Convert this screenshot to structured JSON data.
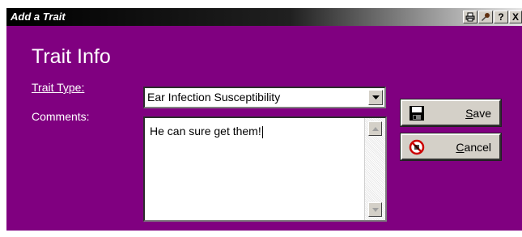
{
  "window": {
    "title": "Add a Trait",
    "colors": {
      "background": "#800080",
      "titlebar": "#000000"
    },
    "controls": {
      "help": "?",
      "close": "X"
    }
  },
  "form": {
    "heading": "Trait Info",
    "trait_type_label": "Trait Type:",
    "trait_type_value": "Ear Infection Susceptibility",
    "comments_label": "Comments:",
    "comments_value": "He can sure get them!"
  },
  "buttons": {
    "save": {
      "mnemonic": "S",
      "rest": "ave",
      "icon": "floppy-disk-icon"
    },
    "cancel": {
      "mnemonic": "C",
      "rest": "ancel",
      "icon": "cancel-icon"
    }
  }
}
